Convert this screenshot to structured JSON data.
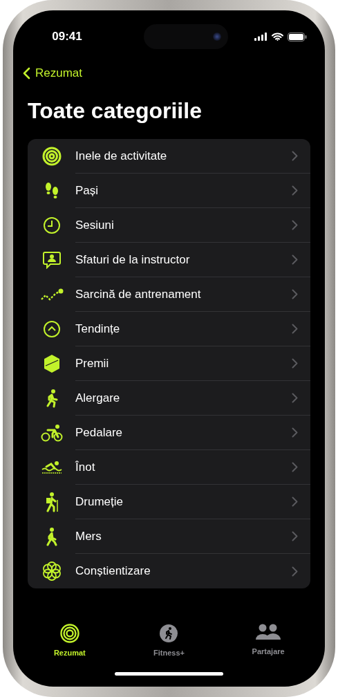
{
  "status_bar": {
    "time": "09:41"
  },
  "back_link": {
    "label": "Rezumat"
  },
  "title": "Toate categoriile",
  "categories": [
    {
      "label": "Inele de activitate"
    },
    {
      "label": "Pași"
    },
    {
      "label": "Sesiuni"
    },
    {
      "label": "Sfaturi de la instructor"
    },
    {
      "label": "Sarcină de antrenament"
    },
    {
      "label": "Tendințe"
    },
    {
      "label": "Premii"
    },
    {
      "label": "Alergare"
    },
    {
      "label": "Pedalare"
    },
    {
      "label": "Înot"
    },
    {
      "label": "Drumeție"
    },
    {
      "label": "Mers"
    },
    {
      "label": "Conștientizare"
    }
  ],
  "tabs": [
    {
      "label": "Rezumat",
      "selected": true
    },
    {
      "label": "Fitness+",
      "selected": false
    },
    {
      "label": "Partajare",
      "selected": false
    }
  ]
}
